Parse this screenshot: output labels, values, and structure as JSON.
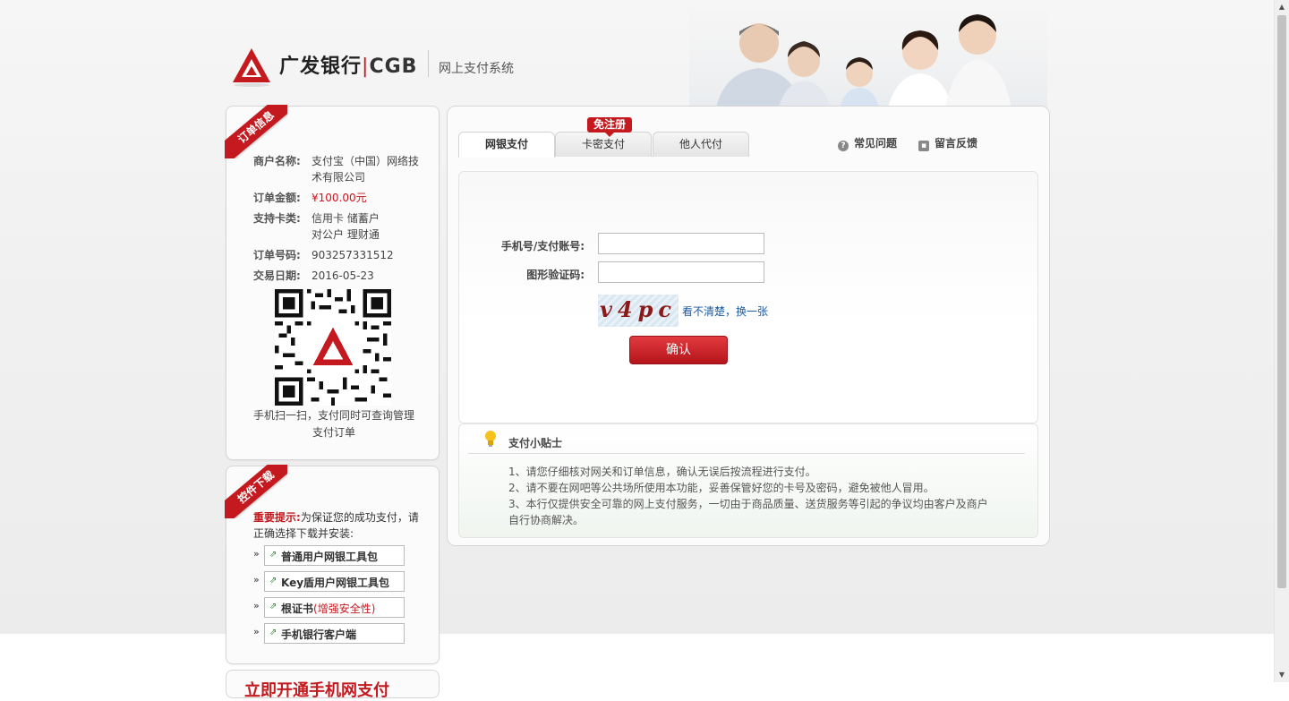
{
  "header": {
    "brand_cn": "广发银行",
    "brand_en": "CGB",
    "system_title": "网上支付系统"
  },
  "order": {
    "ribbon": "订单信息",
    "merchant_label": "商户名称:",
    "merchant_value": "支付宝（中国）网络技术有限公司",
    "amount_label": "订单金额:",
    "amount_value": "¥100.00元",
    "cards_label": "支持卡类:",
    "cards_value_1": "信用卡 储蓄户",
    "cards_value_2": "对公户 理财通",
    "order_no_label": "订单号码:",
    "order_no_value": "903257331512",
    "date_label": "交易日期:",
    "date_value": "2016-05-23",
    "qr_caption": "手机扫一扫，支付同时可查询管理支付订单"
  },
  "download": {
    "ribbon": "控件下载",
    "tip_important": "重要提示:",
    "tip_text": "为保证您的成功支付，请正确选择下载并安装:",
    "items": [
      {
        "label": "普通用户网银工具包",
        "extra": ""
      },
      {
        "label": "Key盾用户网银工具包",
        "extra": ""
      },
      {
        "label": "根证书",
        "extra": "(增强安全性)"
      },
      {
        "label": "手机银行客户端",
        "extra": ""
      }
    ]
  },
  "bottom_panel": {
    "partial_text": "立即开通手机网支付"
  },
  "tabs": [
    {
      "label": "网银支付",
      "active": true
    },
    {
      "label": "卡密支付",
      "active": false
    },
    {
      "label": "他人代付",
      "active": false
    }
  ],
  "badge": "免注册",
  "links": {
    "faq": "常见问题",
    "feedback": "留言反馈"
  },
  "form": {
    "account_label": "手机号/支付账号:",
    "account_value": "",
    "captcha_label": "图形验证码:",
    "captcha_value": "",
    "captcha_image_text": "v4pc",
    "captcha_refresh": "看不清楚，换一张",
    "confirm_button": "确认"
  },
  "tips": {
    "title": "支付小贴士",
    "items": [
      "1、请您仔细核对网关和订单信息，确认无误后按流程进行支付。",
      "2、请不要在网吧等公共场所使用本功能，妥善保管好您的卡号及密码，避免被他人冒用。",
      "3、本行仅提供安全可靠的网上支付服务，一切由于商品质量、送货服务等引起的争议均由客户及商户自行协商解决。"
    ]
  },
  "colors": {
    "brand_red": "#c41a1f",
    "link_blue": "#1a5aa0"
  }
}
